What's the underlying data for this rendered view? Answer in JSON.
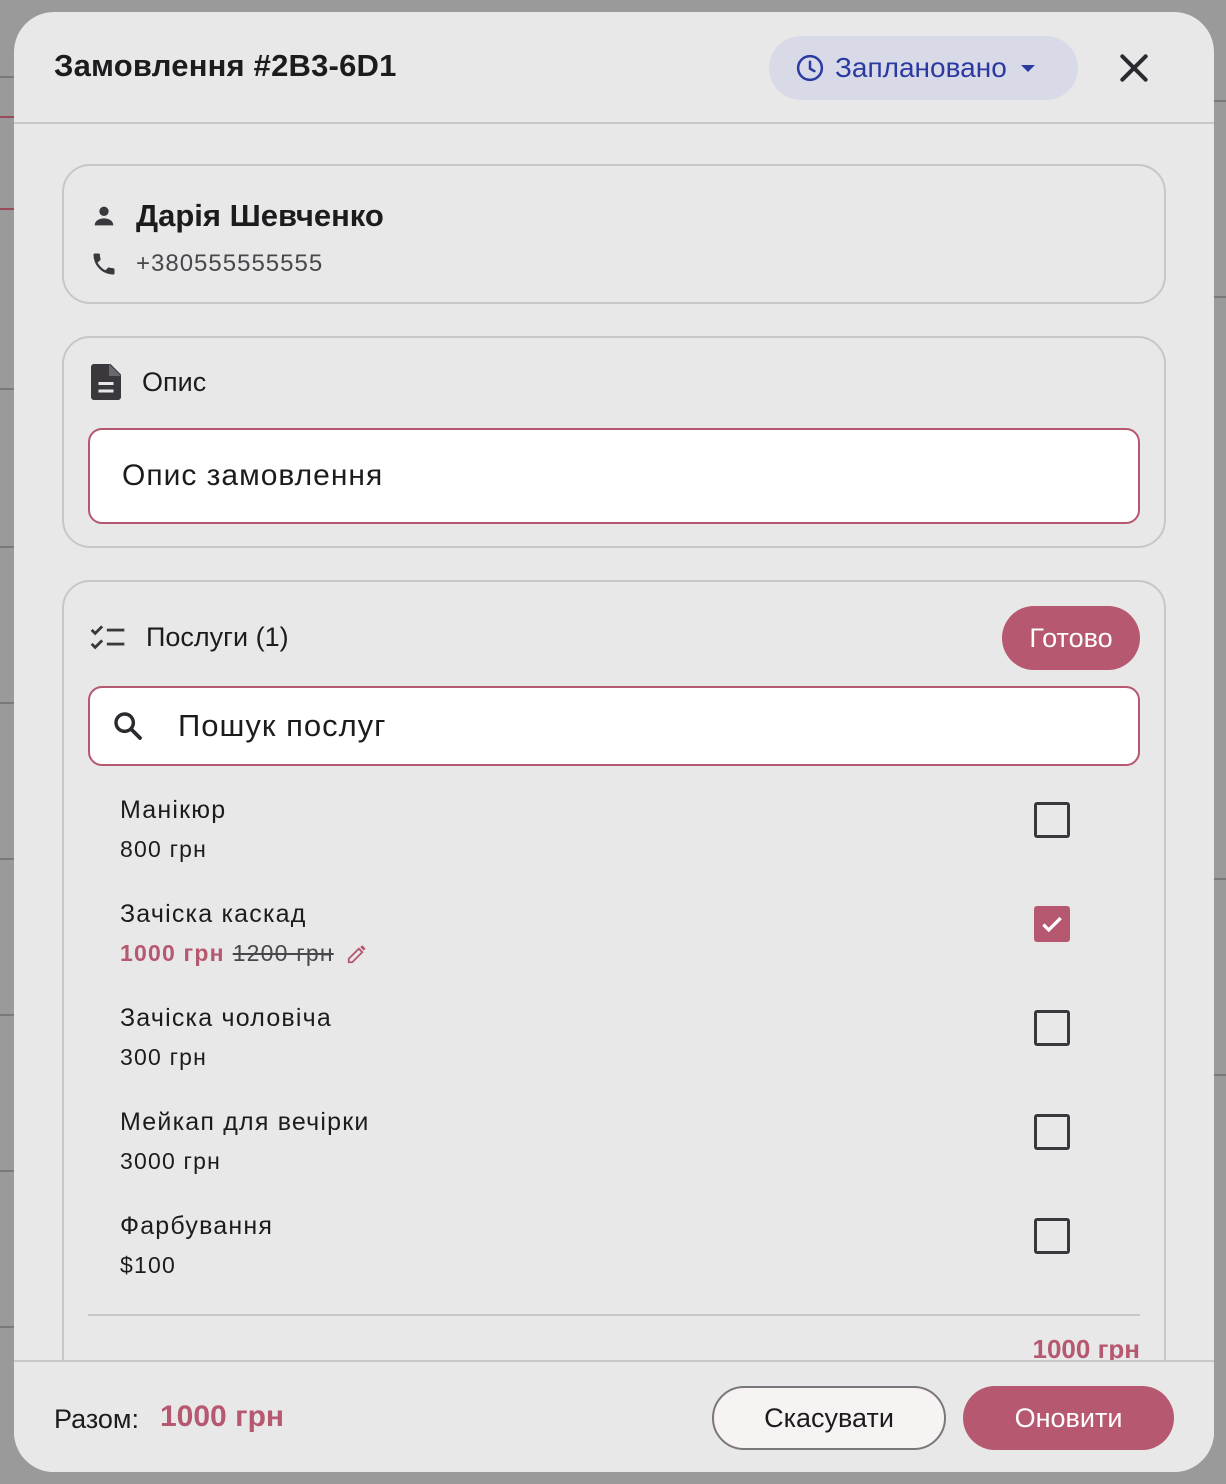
{
  "dialog": {
    "title": "Замовлення #2B3-6D1",
    "status": {
      "label": "Заплановано",
      "icon": "clock-icon",
      "color": "#2a3aa0"
    },
    "close_icon": "close-icon"
  },
  "client": {
    "name": "Дарія Шевченко",
    "phone": "+380555555555"
  },
  "description": {
    "heading": "Опис",
    "value": "Опис замовлення"
  },
  "services": {
    "heading": "Послуги (1)",
    "done_label": "Готово",
    "search_placeholder": "Пошук послуг",
    "items": [
      {
        "name": "Манікюр",
        "price": "800 грн",
        "checked": false
      },
      {
        "name": "Зачіска каскад",
        "price": "1000 грн",
        "old_price": "1200 грн",
        "checked": true
      },
      {
        "name": "Зачіска чоловіча",
        "price": "300 грн",
        "checked": false
      },
      {
        "name": "Мейкап для вечірки",
        "price": "3000 грн",
        "checked": false
      },
      {
        "name": "Фарбування",
        "price": "$100",
        "checked": false
      }
    ],
    "subtotal": "1000 грн"
  },
  "footer": {
    "total_label": "Разом:",
    "total_value": "1000 грн",
    "cancel_label": "Скасувати",
    "update_label": "Оновити"
  },
  "colors": {
    "accent": "#b6586f",
    "chip_bg": "#d9dae8",
    "surface": "#e8e8e8"
  }
}
